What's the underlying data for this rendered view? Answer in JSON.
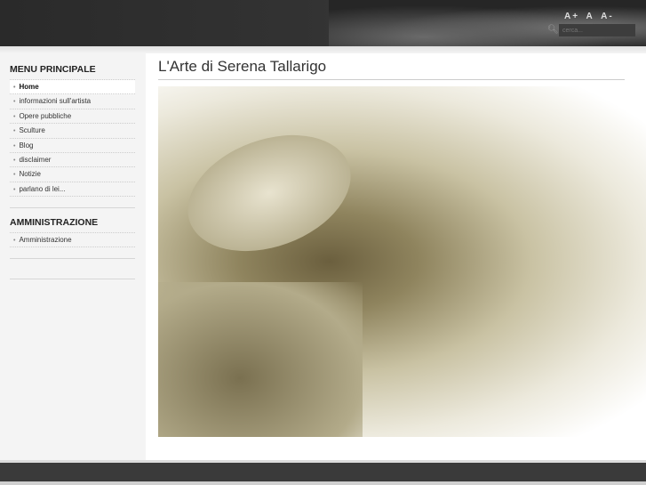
{
  "header": {
    "font_sizes": [
      "A+",
      "A",
      "A-"
    ],
    "search_placeholder": "cerca..."
  },
  "sidebar": {
    "menu_title": "MENU PRINCIPALE",
    "menu_items": [
      "Home",
      "informazioni sull'artista",
      "Opere pubbliche",
      "Sculture",
      "Blog",
      "disclaimer",
      "Notizie",
      "parlano di lei..."
    ],
    "admin_title": "AMMINISTRAZIONE",
    "admin_items": [
      "Amministrazione"
    ]
  },
  "main": {
    "title": "L'Arte di Serena Tallarigo"
  }
}
